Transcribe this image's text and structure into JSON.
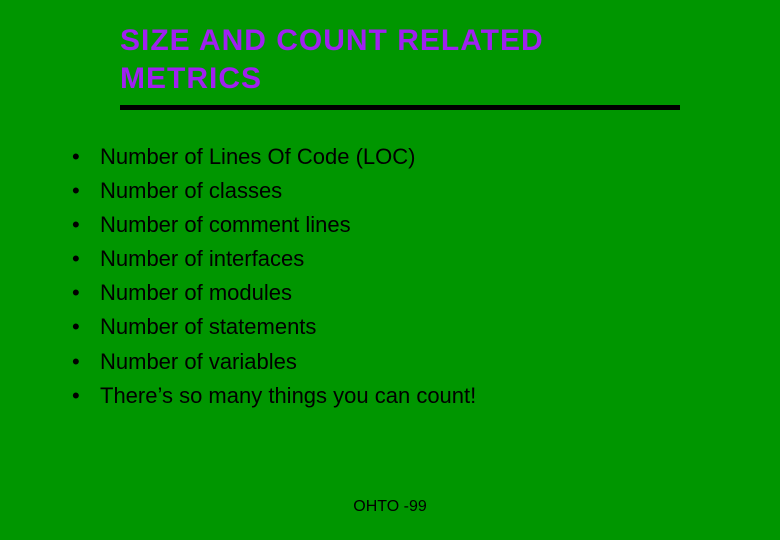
{
  "title": "SIZE AND COUNT RELATED METRICS",
  "bullets": [
    "Number of Lines Of Code (LOC)",
    "Number of classes",
    "Number of comment lines",
    "Number of interfaces",
    "Number of modules",
    "Number of statements",
    "Number of variables",
    "There’s so many things you can count!"
  ],
  "footer": "OHTO -99"
}
